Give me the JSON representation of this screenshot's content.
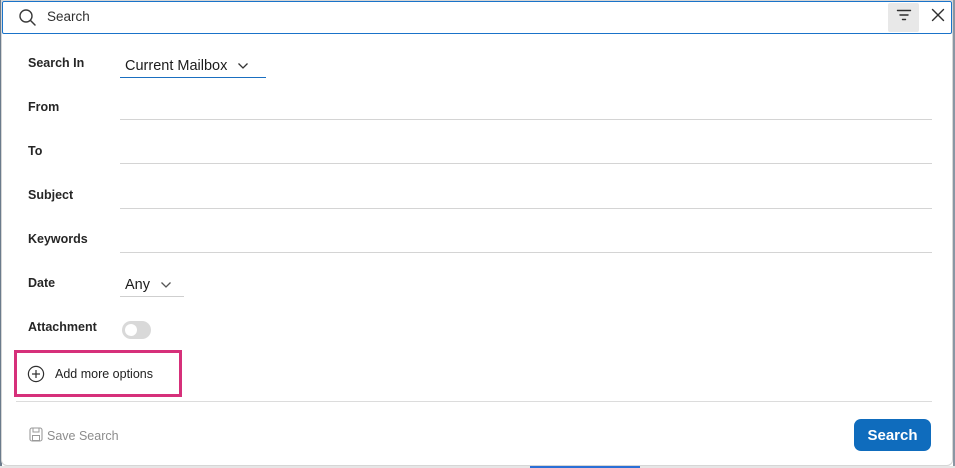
{
  "search": {
    "placeholder": "Search"
  },
  "form": {
    "search_in_label": "Search In",
    "search_in_value": "Current Mailbox",
    "from_label": "From",
    "to_label": "To",
    "subject_label": "Subject",
    "keywords_label": "Keywords",
    "date_label": "Date",
    "date_value": "Any",
    "attachment_label": "Attachment",
    "attachment_on": false
  },
  "actions": {
    "add_more_options": "Add more options",
    "save_search": "Save Search",
    "search_button": "Search"
  },
  "icons": [
    "search-icon",
    "filter-icon",
    "close-icon",
    "chevron-down-icon",
    "add-circle-icon",
    "save-icon"
  ],
  "colors": {
    "accent": "#0f6cbd",
    "highlight": "#d6307a",
    "search_border": "#1a73c9"
  }
}
